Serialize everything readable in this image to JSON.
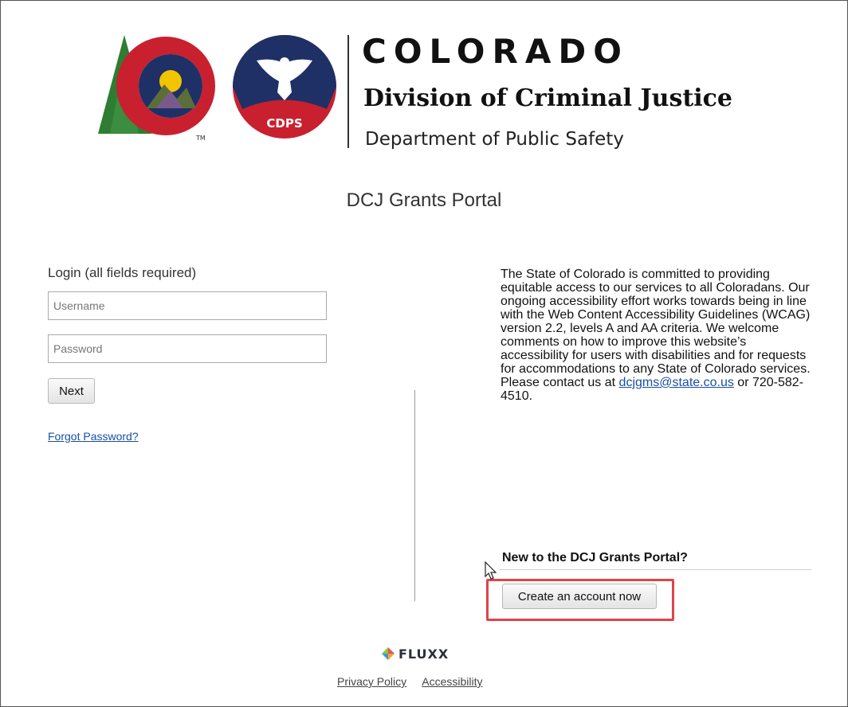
{
  "header": {
    "state_name": "COLORADO",
    "division": "Division of Criminal Justice",
    "department": "Department of Public Safety",
    "cdps_badge": "CDPS",
    "trademark": "TM"
  },
  "page_title": "DCJ Grants Portal",
  "login": {
    "label": "Login (all fields required)",
    "username_placeholder": "Username",
    "password_placeholder": "Password",
    "next_label": "Next",
    "forgot_label": "Forgot Password?"
  },
  "accessibility": {
    "body": "The State of Colorado is committed to providing equitable access to our services to all Coloradans. Our ongoing accessibility effort works towards being in line with the Web Content Accessibility Guidelines (WCAG) version 2.2, levels A and AA criteria. We welcome comments on how to improve this website’s accessibility for users with disabilities and for requests for accommodations to any State of Colorado services. Please contact us at",
    "email": "dcjgms@state.co.us",
    "phone_suffix": "or 720-582-4510."
  },
  "signup": {
    "heading": "New to the DCJ Grants Portal?",
    "button_label": "Create an account now"
  },
  "footer": {
    "brand": "FLUXX",
    "links": [
      "Privacy Policy",
      "Accessibility"
    ]
  },
  "colors": {
    "link": "#1a4fa3",
    "highlight": "#e0434a",
    "co_red": "#c8202f",
    "co_blue": "#1e3066",
    "co_gold": "#f2c400",
    "tree_green": "#2e7d32"
  },
  "icons": [
    "colorado-logo",
    "cdps-eagle-logo",
    "mouse-cursor-icon",
    "fluxx-logo-icon"
  ]
}
